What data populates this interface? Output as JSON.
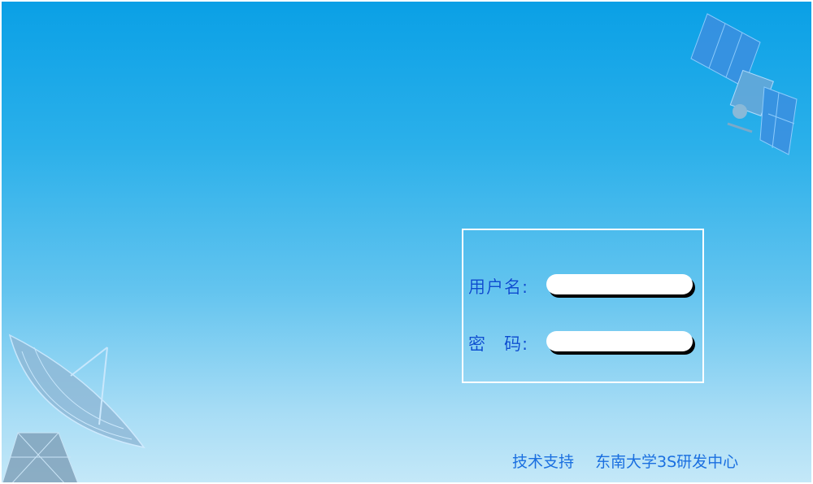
{
  "login": {
    "username_label": "用户名:",
    "username_value": "",
    "password_label": "密　码:",
    "password_value": ""
  },
  "footer": {
    "support_label": "技术支持",
    "organization": "东南大学3S研发中心"
  },
  "colors": {
    "background_top": "#0aa0e6",
    "background_bottom": "#c4e8f8",
    "label_text": "#0a4fd0",
    "footer_text": "#1a6fe0",
    "box_border": "#ffffff"
  },
  "icons": {
    "top_right": "satellite-icon",
    "bottom_left": "radar-dish-icon"
  }
}
